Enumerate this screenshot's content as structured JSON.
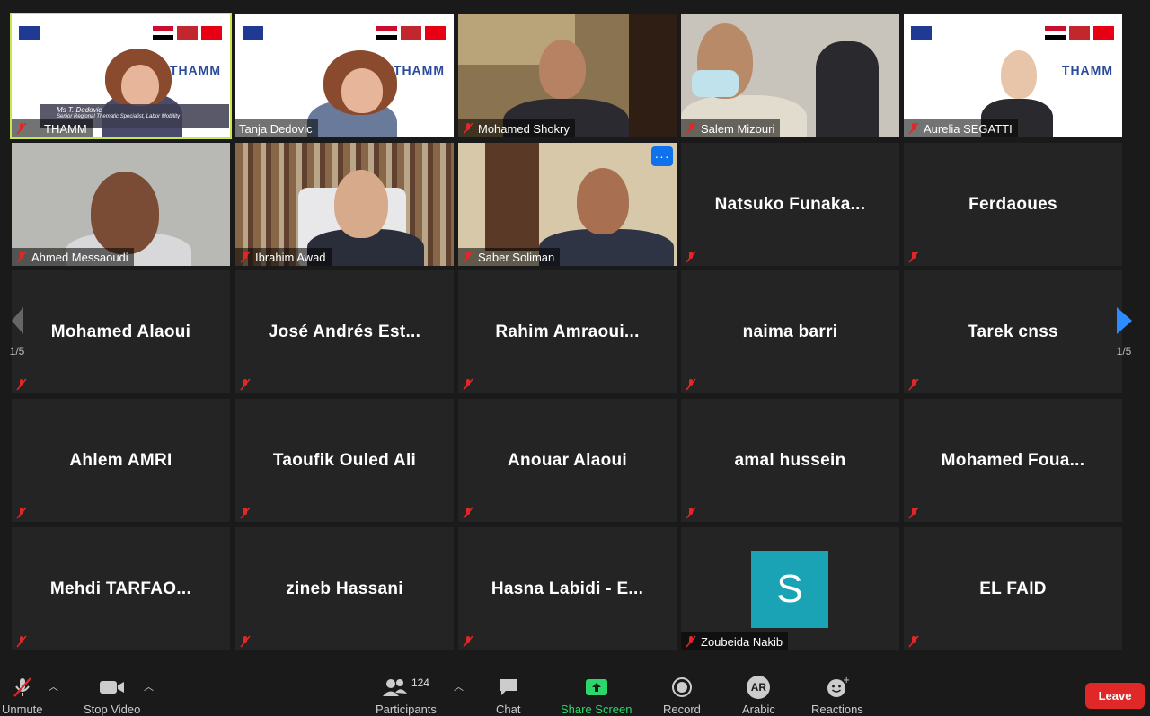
{
  "gallery": {
    "page_left": "1/5",
    "page_right": "1/5",
    "row1": [
      {
        "name": "THAMM",
        "slide_name": "Ms T. Dedovic",
        "slide_role": "Senior Regional Thematic Specialist, Labor Mobility"
      },
      {
        "name": "Tanja Dedovic"
      },
      {
        "name": "Mohamed Shokry"
      },
      {
        "name": "Salem Mizouri"
      },
      {
        "name": "Aurelia SEGATTI"
      }
    ],
    "row2": [
      {
        "name": "Ahmed Messaoudi"
      },
      {
        "name": "Ibrahim Awad"
      },
      {
        "name": "Saber Soliman"
      },
      {
        "big": "Natsuko  Funaka..."
      },
      {
        "big": "Ferdaoues"
      }
    ],
    "row3": [
      "Mohamed Alaoui",
      "José  Andrés  Est...",
      "Rahim  Amraoui...",
      "naima barri",
      "Tarek cnss"
    ],
    "row4": [
      "Ahlem AMRI",
      "Taoufik Ouled Ali",
      "Anouar Alaoui",
      "amal hussein",
      "Mohamed  Foua..."
    ],
    "row5": [
      "Mehdi  TARFAO...",
      "zineb Hassani",
      "Hasna Labidi - E...",
      "",
      "EL FAID"
    ],
    "avatar_tile": {
      "initial": "S",
      "name": "Zoubeida Nakib"
    },
    "thamm_logo": "THAMM"
  },
  "toolbar": {
    "unmute": "Unmute",
    "stop_video": "Stop Video",
    "participants": "Participants",
    "participant_count": "124",
    "chat": "Chat",
    "share_screen": "Share Screen",
    "record": "Record",
    "arabic": "Arabic",
    "arabic_badge": "AR",
    "reactions": "Reactions",
    "leave": "Leave"
  },
  "colors": {
    "accent_green": "#2bd66a",
    "active_speaker": "#c6e84a",
    "leave_red": "#e02828",
    "nav_blue": "#2d8cff",
    "avatar_teal": "#1aa2b5"
  }
}
